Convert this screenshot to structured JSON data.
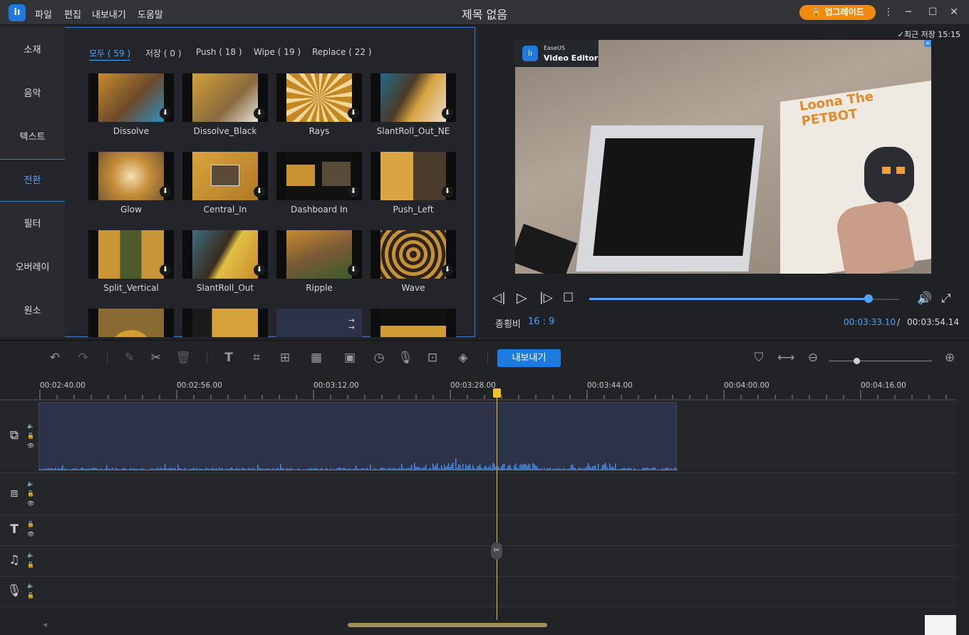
{
  "app": {
    "title": "제목 없음",
    "logo": "iı",
    "upgrade": "업그레이드"
  },
  "menu": [
    "파일",
    "편집",
    "내보내기",
    "도움말"
  ],
  "sidebar": [
    "소재",
    "음악",
    "텍스트",
    "전환",
    "필터",
    "오버레이",
    "원소"
  ],
  "tabs": [
    "모두 ( 59 )",
    "저장 ( 0 )",
    "Push ( 18 )",
    "Wipe ( 19 )",
    "Replace ( 22 )"
  ],
  "thumbs": [
    "Dissolve",
    "Dissolve_Black",
    "Rays",
    "SlantRoll_Out_NE",
    "Glow",
    "Central_In",
    "Dashboard In",
    "Push_Left",
    "Split_Vertical",
    "SlantRoll_Out",
    "Ripple",
    "Wave"
  ],
  "preview": {
    "last_saved": "최근 저장 15:15",
    "badge_brand": "EaseUS",
    "badge_product": "Video Editor",
    "box_title_1": "Loona",
    "box_title_2": "The",
    "box_title_3": "PETBOT",
    "aspect_label": "종횡비",
    "aspect_value": "16 : 9",
    "current_time": "00:03:33.10",
    "separator": "/",
    "total_time": "00:03:54.14",
    "progress": 0.9
  },
  "toolbar": {
    "export": "내보내기"
  },
  "ruler": [
    "00:02:40.00",
    "00:02:56.00",
    "00:03:12.00",
    "00:03:28.00",
    "00:03:44.00",
    "00:04:00.00",
    "00:04:16.00"
  ],
  "colors": {
    "accent": "#1f7ae0",
    "active_text": "#4da3ff",
    "upgrade": "#f28a0f",
    "playhead": "#f0c12b"
  }
}
